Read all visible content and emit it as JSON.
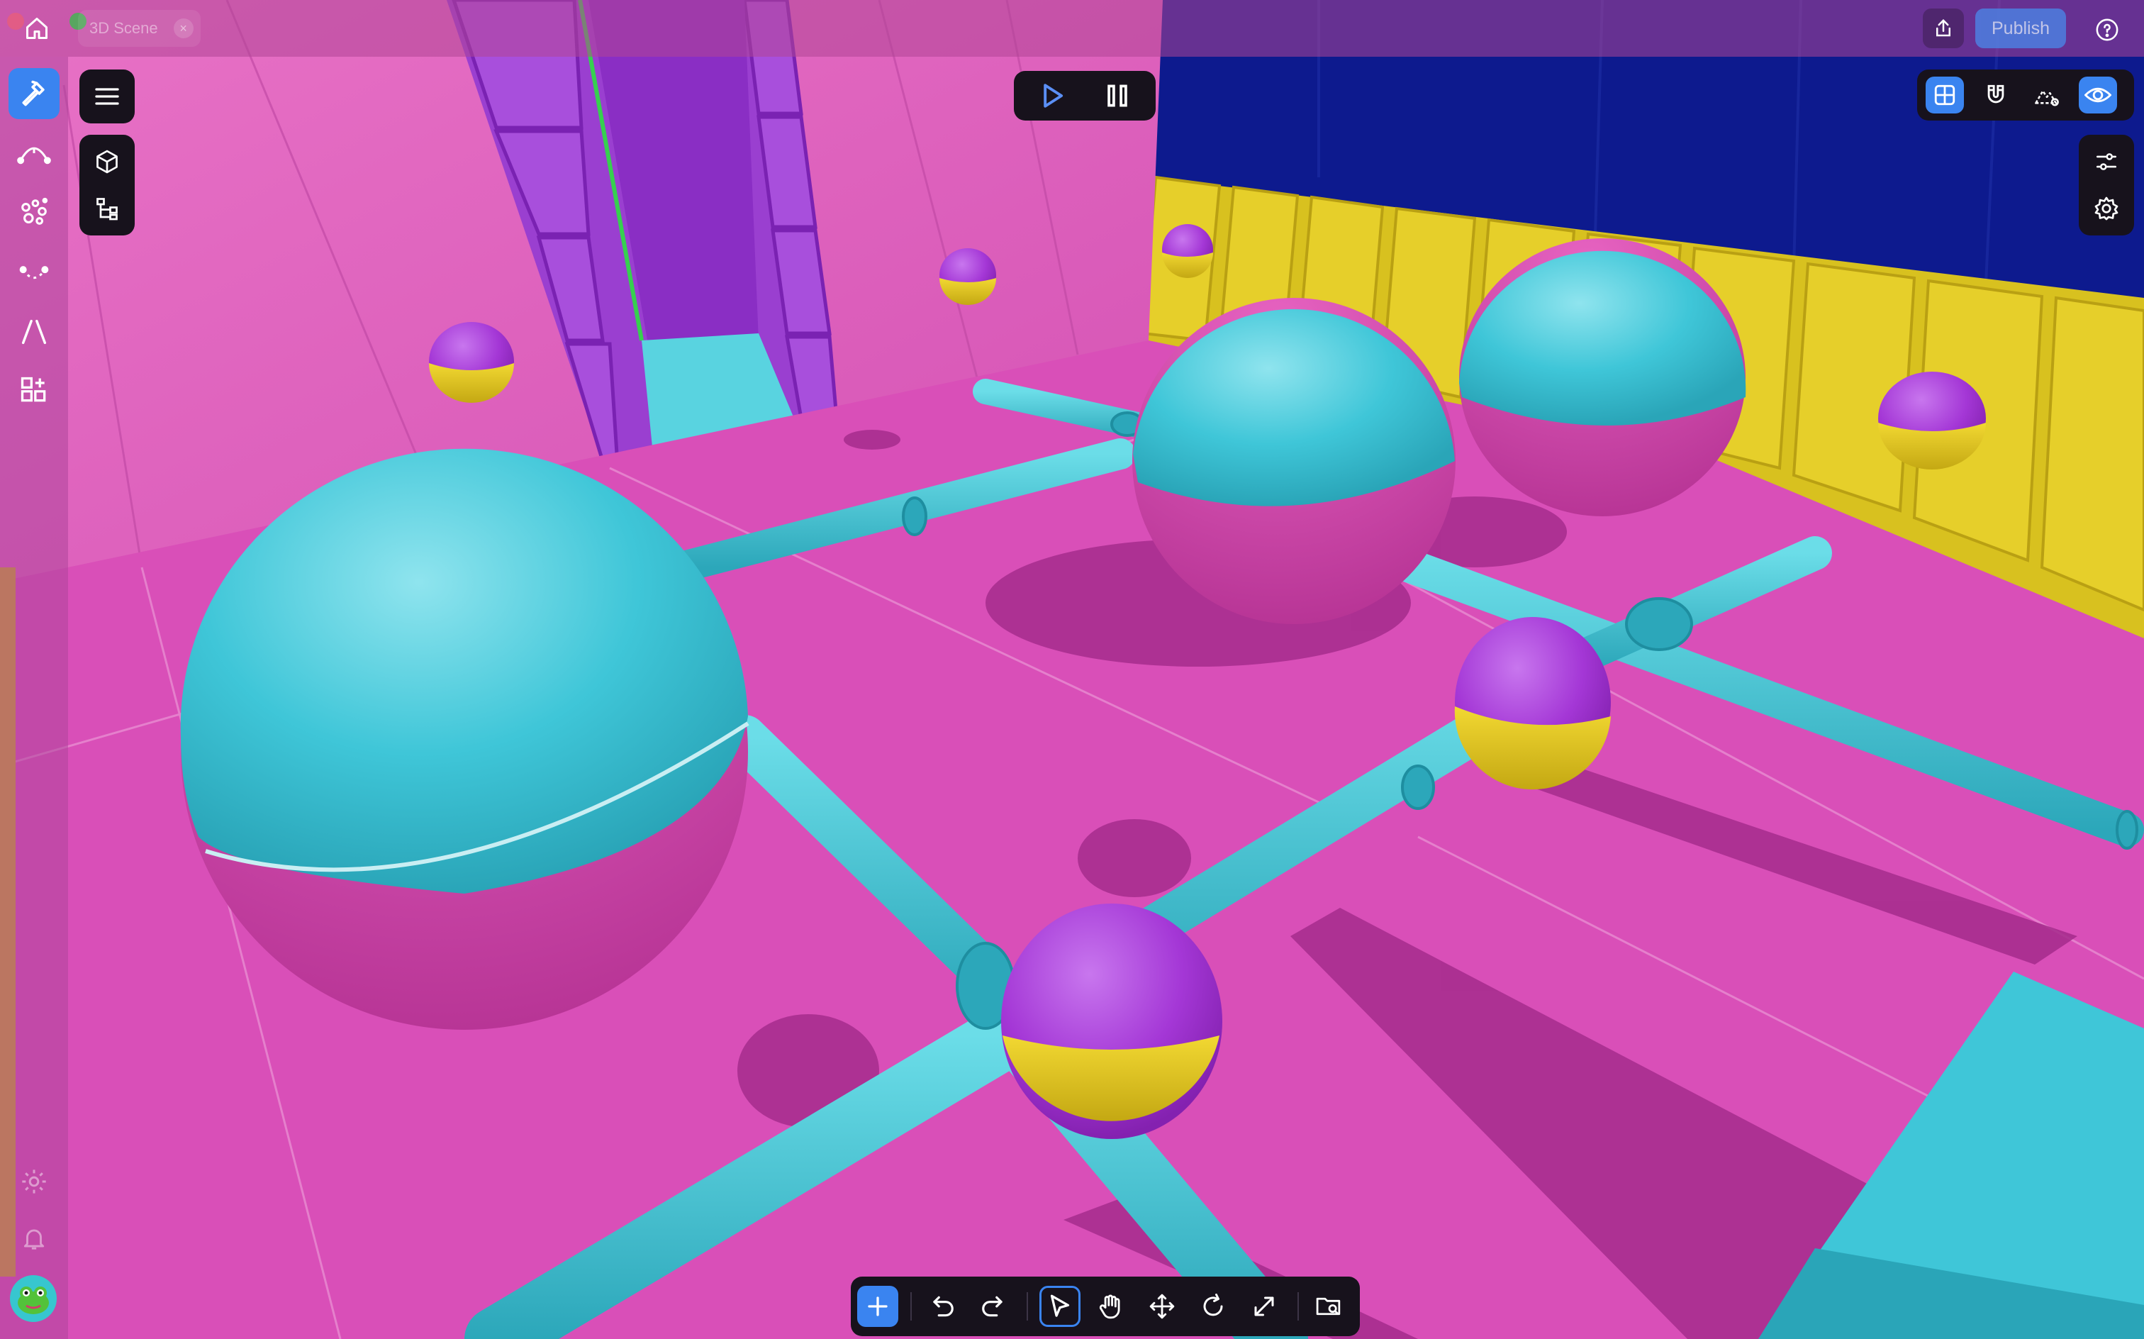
{
  "window": {
    "document_tab": "3D Scene",
    "tab_close_glyph": "×",
    "traffic_colors": [
      "#ff5f57",
      "#febc2e",
      "#28c840"
    ]
  },
  "header": {
    "publish_label": "Publish",
    "icons": [
      "home-icon",
      "share-icon",
      "help-icon"
    ]
  },
  "left_rail": {
    "items": [
      {
        "name": "build-hammer-icon",
        "active": true
      },
      {
        "name": "path-curve-icon",
        "active": false
      },
      {
        "name": "particles-icon",
        "active": false
      },
      {
        "name": "arc-points-icon",
        "active": false
      },
      {
        "name": "lines-icon",
        "active": false
      },
      {
        "name": "add-widget-icon",
        "active": false
      }
    ],
    "bottom_items": [
      "settings-gear-icon",
      "notifications-bell-icon",
      "user-avatar"
    ]
  },
  "viewport_tools": {
    "left": [
      "menu-icon",
      "cube-icon",
      "hierarchy-icon"
    ],
    "playback": [
      "play-icon",
      "pause-icon"
    ],
    "view_modes": [
      {
        "name": "grid-view-icon",
        "active": true
      },
      {
        "name": "magnet-snap-icon",
        "active": false
      },
      {
        "name": "terrain-icon",
        "active": false
      },
      {
        "name": "visibility-eye-icon",
        "active": true
      }
    ],
    "right": [
      "sliders-icon",
      "settings-icon"
    ]
  },
  "bottom_toolbar": [
    {
      "name": "add-icon",
      "state": "primary"
    },
    {
      "name": "undo-icon",
      "state": ""
    },
    {
      "name": "redo-icon",
      "state": ""
    },
    {
      "name": "select-pointer-icon",
      "state": "selected"
    },
    {
      "name": "hand-pan-icon",
      "state": ""
    },
    {
      "name": "move-arrows-icon",
      "state": ""
    },
    {
      "name": "rotate-icon",
      "state": ""
    },
    {
      "name": "scale-icon",
      "state": ""
    },
    {
      "name": "asset-folder-icon",
      "state": ""
    }
  ],
  "colors": {
    "pink": "#d94fb8",
    "cyan": "#3fc6d8",
    "purple": "#a437d6",
    "yellow": "#d8c11f",
    "navy": "#0d1a8e",
    "accent": "#3a84f0",
    "panel": "#17121c"
  }
}
